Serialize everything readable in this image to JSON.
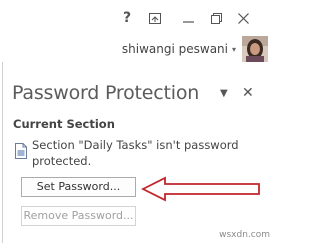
{
  "titlebar": {
    "help_label": "?",
    "ribbon_label": "⊼",
    "minimize_label": "—",
    "restore_label": "⧉",
    "close_label": "✕"
  },
  "account": {
    "name": "shiwangi peswani",
    "caret": "▾"
  },
  "pane": {
    "title": "Password Protection",
    "dropdown_label": "▼",
    "close_label": "✕",
    "section_heading": "Current Section",
    "info_text": "Section \"Daily Tasks\" isn't password protected.",
    "set_password_label": "Set Password...",
    "remove_password_label": "Remove Password..."
  },
  "annotation": {
    "arrow_color": "#c0262b"
  },
  "watermark": "wsxdn.com"
}
